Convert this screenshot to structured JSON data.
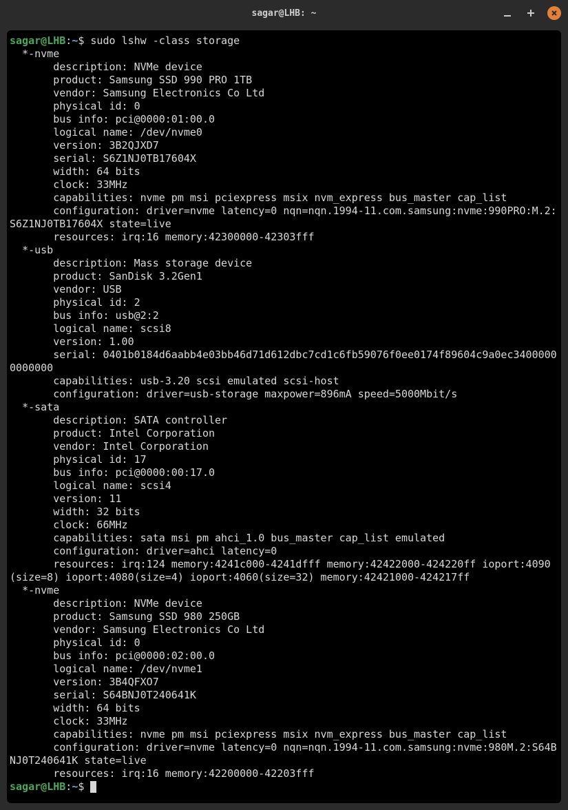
{
  "window": {
    "title": "sagar@LHB: ~"
  },
  "prompt": {
    "user": "sagar",
    "at": "@",
    "host": "LHB",
    "colon": ":",
    "path": "~",
    "symbol": "$"
  },
  "command": "sudo lshw -class storage",
  "output": "  *-nvme\n       description: NVMe device\n       product: Samsung SSD 990 PRO 1TB\n       vendor: Samsung Electronics Co Ltd\n       physical id: 0\n       bus info: pci@0000:01:00.0\n       logical name: /dev/nvme0\n       version: 3B2QJXD7\n       serial: S6Z1NJ0TB17604X\n       width: 64 bits\n       clock: 33MHz\n       capabilities: nvme pm msi pciexpress msix nvm_express bus_master cap_list\n       configuration: driver=nvme latency=0 nqn=nqn.1994-11.com.samsung:nvme:990PRO:M.2:S6Z1NJ0TB17604X state=live\n       resources: irq:16 memory:42300000-42303fff\n  *-usb\n       description: Mass storage device\n       product: SanDisk 3.2Gen1\n       vendor: USB\n       physical id: 2\n       bus info: usb@2:2\n       logical name: scsi8\n       version: 1.00\n       serial: 0401b0184d6aabb4e03bb46d71d612dbc7cd1c6fb59076f0ee0174f89604c9a0ec34000000000000\n       capabilities: usb-3.20 scsi emulated scsi-host\n       configuration: driver=usb-storage maxpower=896mA speed=5000Mbit/s\n  *-sata\n       description: SATA controller\n       product: Intel Corporation\n       vendor: Intel Corporation\n       physical id: 17\n       bus info: pci@0000:00:17.0\n       logical name: scsi4\n       version: 11\n       width: 32 bits\n       clock: 66MHz\n       capabilities: sata msi pm ahci_1.0 bus_master cap_list emulated\n       configuration: driver=ahci latency=0\n       resources: irq:124 memory:4241c000-4241dfff memory:42422000-424220ff ioport:4090(size=8) ioport:4080(size=4) ioport:4060(size=32) memory:42421000-424217ff\n  *-nvme\n       description: NVMe device\n       product: Samsung SSD 980 250GB\n       vendor: Samsung Electronics Co Ltd\n       physical id: 0\n       bus info: pci@0000:02:00.0\n       logical name: /dev/nvme1\n       version: 3B4QFXO7\n       serial: S64BNJ0T240641K\n       width: 64 bits\n       clock: 33MHz\n       capabilities: nvme pm msi pciexpress msix nvm_express bus_master cap_list\n       configuration: driver=nvme latency=0 nqn=nqn.1994-11.com.samsung:nvme:980M.2:S64BNJ0T240641K state=live\n       resources: irq:16 memory:42200000-42203fff"
}
